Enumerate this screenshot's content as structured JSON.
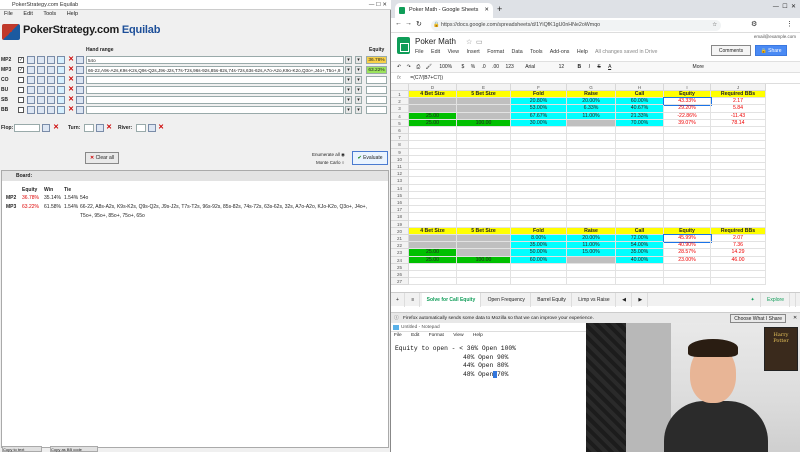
{
  "equilab": {
    "window_title": "PokerStrategy.com Equilab",
    "menu": [
      "File",
      "Edit",
      "Tools",
      "Help"
    ],
    "logo_text_a": "PokerStrategy.com",
    "logo_text_b": " Equilab",
    "hand_range_header": "Hand range",
    "equity_header": "Equity",
    "players": [
      {
        "label": "MP2",
        "range": "54o",
        "equity": "36.78%",
        "checked": true
      },
      {
        "label": "MP3",
        "range": "66-22,A9s-A2s,K9s-K2s,Q9s-Q2s,J9s-J2s,T7s-T2s,96s-92s,85s-82s,74s-72s,63s-62s,A7o-A2o,K9o-K2o,Q3o+,J4o+,T5o+,9",
        "equity": "63.22%",
        "checked": true
      },
      {
        "label": "CO",
        "range": "",
        "equity": "",
        "checked": false
      },
      {
        "label": "BU",
        "range": "",
        "equity": "",
        "checked": false
      },
      {
        "label": "SB",
        "range": "",
        "equity": "",
        "checked": false
      },
      {
        "label": "BB",
        "range": "",
        "equity": "",
        "checked": false
      }
    ],
    "flop_label": "Flop:",
    "turn_label": "Turn:",
    "river_label": "River:",
    "clear_all": "Clear all",
    "enumerate_all": "Enumerate all",
    "monte_carlo": "Monte Carlo",
    "evaluate": "Evaluate",
    "results": {
      "board_label": "Board:",
      "col_equity": "Equity",
      "col_win": "Win",
      "col_tie": "Tie",
      "rows": [
        {
          "player": "MP2",
          "equity": "36.78%",
          "win": "35.14%",
          "tie": "1.54%",
          "hands": "54o"
        },
        {
          "player": "MP3",
          "equity": "63.22%",
          "win": "61.58%",
          "tie": "1.54%",
          "hands": "66-22, A8s-A2s, K9s-K2s, Q9s-Q2s, J9s-J2s, T7s-T2s, 96s-92s, 85s-82s, 74s-72s, 63s-62s, 32s, A7o-A2o, KJo-K2o, Q3o+, J4o+,"
        },
        {
          "player": "",
          "equity": "",
          "win": "",
          "tie": "",
          "hands": "T5o+, 95o+, 85o+, 75o+, 65o"
        }
      ]
    },
    "task_buttons": [
      "Copy to text",
      "Copy as BB code"
    ]
  },
  "browser": {
    "tab_title": "Poker Math - Google Sheets",
    "url": "https://docs.google.com/spreadsheets/d/1YiQfK1gU0nHNe2oWmqo",
    "doc_title": "Poker Math",
    "doc_menu": [
      "File",
      "Edit",
      "View",
      "Insert",
      "Format",
      "Data",
      "Tools",
      "Add-ons",
      "Help"
    ],
    "save_status": "All changes saved in Drive",
    "account": "email@example.com",
    "comments": "Comments",
    "share": "Share",
    "toolbar_items": [
      "100%",
      "$",
      "%",
      ".0",
      ".00",
      "123",
      "Arial",
      "12",
      "B",
      "I",
      "S",
      "A",
      "More"
    ],
    "formula_text": "=(C7/(B7+C7))",
    "columns": [
      "D",
      "E",
      "F",
      "G",
      "H",
      "I",
      "J"
    ],
    "table1_headers": [
      "4 Bet Size",
      "5 Bet Size",
      "Fold",
      "Raise",
      "Call",
      "Equity",
      "Required BBs"
    ],
    "table1_rows": [
      {
        "row": "2",
        "c": [
          "",
          "",
          "20.80%",
          "20.00%",
          "60.00%",
          "43.33%",
          "2.17"
        ]
      },
      {
        "row": "3",
        "c": [
          "",
          "",
          "53.00%",
          "6.33%",
          "40.67%",
          "29.20%",
          "5.84"
        ]
      },
      {
        "row": "4",
        "c": [
          "25.00",
          "",
          "67.67%",
          "11.00%",
          "21.33%",
          "-22.86%",
          "-11.43"
        ]
      },
      {
        "row": "5",
        "c": [
          "25.00",
          "100.00",
          "30.00%",
          "",
          "70.00%",
          "39.07%",
          "78.14"
        ]
      }
    ],
    "table2_headers": [
      "4 Bet Size",
      "5 Bet Size",
      "Fold",
      "Raise",
      "Call",
      "Equity",
      "Required BBs"
    ],
    "table2_rows": [
      {
        "row": "21",
        "c": [
          "",
          "",
          "8.00%",
          "20.00%",
          "72.00%",
          "45.99%",
          "2.07"
        ]
      },
      {
        "row": "22",
        "c": [
          "",
          "",
          "35.00%",
          "11.00%",
          "54.00%",
          "40.90%",
          "7.36"
        ]
      },
      {
        "row": "23",
        "c": [
          "25.00",
          "",
          "50.00%",
          "15.00%",
          "35.00%",
          "28.57%",
          "14.29"
        ]
      },
      {
        "row": "24",
        "c": [
          "25.00",
          "100.00",
          "60.00%",
          "",
          "40.00%",
          "23.00%",
          "46.00"
        ]
      }
    ],
    "sheet_tabs": [
      "Solve for Call Equity",
      "Open Frequency",
      "Barrel Equity",
      "Limp vs Raise"
    ],
    "explore": "Explore",
    "notification": "Firefox automatically sends some data to Mozilla so that we can improve your experience.",
    "choose_share": "Choose What I Share"
  },
  "notepad": {
    "title": "Untitled - Notepad",
    "menu": [
      "File",
      "Edit",
      "Format",
      "View",
      "Help"
    ],
    "line1": "Equity to open - < 36% Open 100%",
    "line2": "                  40% Open 90%",
    "line3": "                  44% Open 80%",
    "line4a": "                  48% Open",
    "line4_sel": " ",
    "line4b": "70%"
  },
  "webcam": {
    "poster_text": "Harry Potter"
  }
}
